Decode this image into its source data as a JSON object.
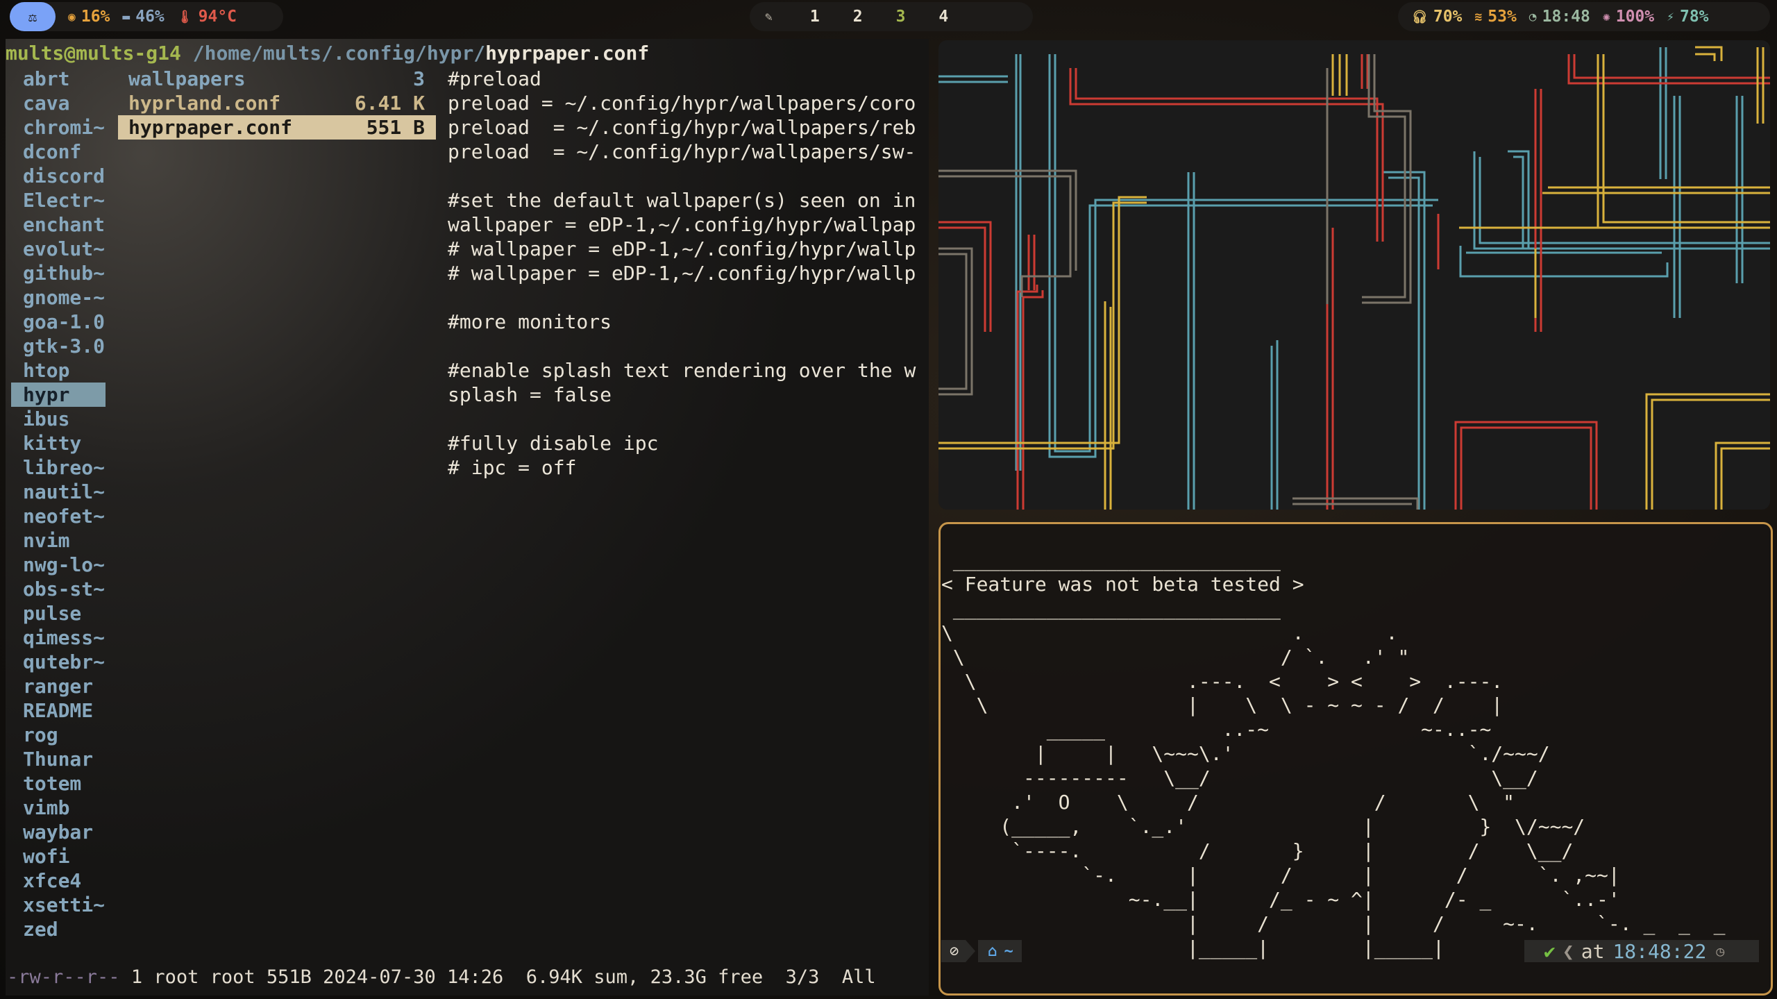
{
  "topbar": {
    "logo_icon": "arch-icon",
    "cpu": "16%",
    "memory": "46%",
    "temperature": "94°C",
    "workspace_icon": "pen-icon",
    "workspaces": [
      "1",
      "2",
      "3",
      "4"
    ],
    "volume": "70%",
    "wifi": "53%",
    "clock": "18:48",
    "brightness": "100%",
    "battery": "78%",
    "colors": {
      "cpu": "#e6a23c",
      "memory": "#8aa4c1",
      "temperature": "#e05a4b",
      "volume": "#e6c26a",
      "wifi": "#e6a23c",
      "clock": "#9bb8a0",
      "brightness": "#d08fb0",
      "battery": "#7fc0b0"
    }
  },
  "ranger": {
    "path": {
      "user_host": "mults@mults-g14",
      "dir": " /home/mults/.config/hypr/",
      "file": "hyprpaper.conf"
    },
    "parent_dirs": [
      "abrt",
      "cava",
      "chromi~",
      "dconf",
      "discord",
      "Electr~",
      "enchant",
      "evolut~",
      "github~",
      "gnome-~",
      "goa-1.0",
      "gtk-3.0",
      "htop",
      "hypr",
      "ibus",
      "kitty",
      "libreo~",
      "nautil~",
      "neofet~",
      "nvim",
      "nwg-lo~",
      "obs-st~",
      "pulse",
      "qimess~",
      "qutebr~",
      "ranger",
      "README",
      "rog",
      "Thunar",
      "totem",
      "vimb",
      "waybar",
      "wofi",
      "xfce4",
      "xsetti~",
      "zed"
    ],
    "selected_parent": "hypr",
    "files": [
      {
        "name": "wallpapers",
        "size": "3",
        "type": "dir"
      },
      {
        "name": "hyprland.conf",
        "size": "6.41 K",
        "type": "file"
      },
      {
        "name": "hyprpaper.conf",
        "size": "551 B",
        "type": "file",
        "selected": true
      }
    ],
    "preview": [
      "#preload",
      "preload = ~/.config/hypr/wallpapers/coro",
      "preload  = ~/.config/hypr/wallpapers/reb",
      "preload  = ~/.config/hypr/wallpapers/sw-",
      "",
      "#set the default wallpaper(s) seen on in",
      "wallpaper = eDP-1,~/.config/hypr/wallpap",
      "# wallpaper = eDP-1,~/.config/hypr/wallp",
      "# wallpaper = eDP-1,~/.config/hypr/wallp",
      "",
      "#more monitors",
      "",
      "#enable splash text rendering over the w",
      "splash = false",
      "",
      "#fully disable ipc",
      "# ipc = off"
    ],
    "status": {
      "permissions": "-rw-r--r--",
      "details": " 1 root root 551B 2024-07-30 14:26  6.94K sum, 23.3G free  3/3  All"
    }
  },
  "cowsay": {
    "art": " ____________________________\n< Feature was not beta tested >\n ____________________________\n\\                             .       .\n \\                           / `.   .' \"\n  \\                  .---.  <    > <    >  .---.\n   \\                 |    \\  \\ - ~ ~ - /  /    |\n         _____          ..-~             ~-..-~\n        |     |   \\~~~\\.'                    `./~~~/\n       ---------   \\__/                        \\__/\n      .'  O    \\     /               /       \\  \"\n     (_____,    `._.'               |         }  \\/~~~/\n      `----.          /       }     |        /    \\__/\n            `-.      |       /      |       /      `. ,~~|\n                ~-.__|      /_ - ~ ^|      /- _      `..-'\n                     |     /        |     /     ~-.     `-. _  _  _\n                     |_____|        |_____|         ~ - . _ _ _ _ _>"
  },
  "prompt": {
    "os_icon": "arch-icon",
    "home_icon": "home-icon",
    "dir": "~",
    "status_ok": "✔",
    "at_label": "at",
    "time": "18:48:22",
    "clock_icon": "clock-icon"
  }
}
